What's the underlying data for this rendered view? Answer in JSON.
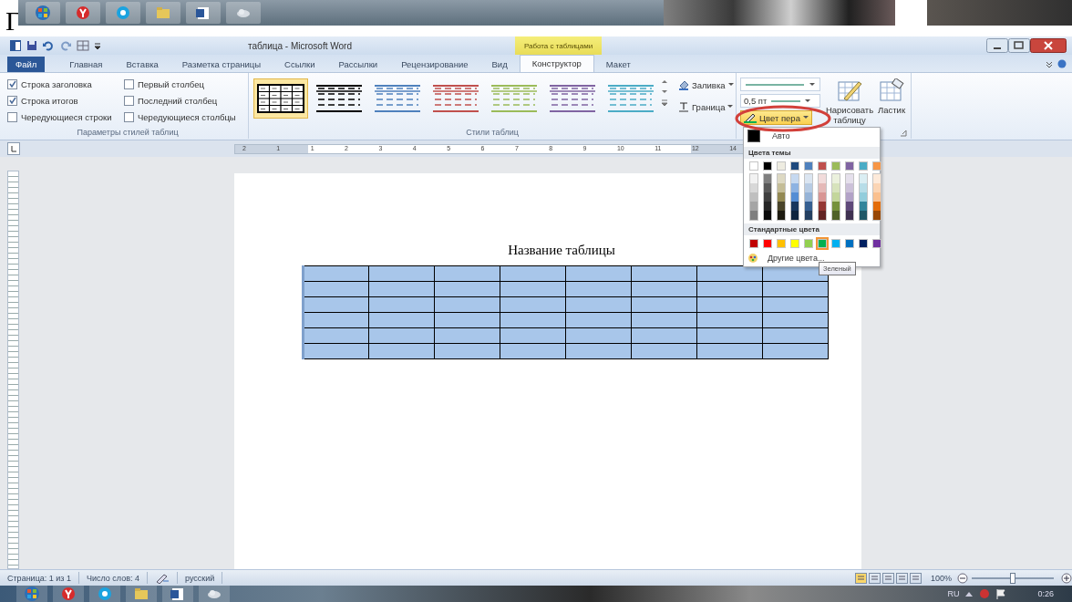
{
  "top_strip": {
    "letter": "Г"
  },
  "title_bar": {
    "title": "таблица - Microsoft Word",
    "context_header": "Работа с таблицами"
  },
  "tabs": [
    {
      "label": "Файл",
      "kind": "file",
      "selected": false
    },
    {
      "label": "Главная",
      "kind": "normal",
      "selected": false
    },
    {
      "label": "Вставка",
      "kind": "normal",
      "selected": false
    },
    {
      "label": "Разметка страницы",
      "kind": "normal",
      "selected": false
    },
    {
      "label": "Ссылки",
      "kind": "normal",
      "selected": false
    },
    {
      "label": "Рассылки",
      "kind": "normal",
      "selected": false
    },
    {
      "label": "Рецензирование",
      "kind": "normal",
      "selected": false
    },
    {
      "label": "Вид",
      "kind": "normal",
      "selected": false
    },
    {
      "label": "Конструктор",
      "kind": "context",
      "selected": true
    },
    {
      "label": "Макет",
      "kind": "context",
      "selected": false
    }
  ],
  "ribbon": {
    "style_options": {
      "label": "Параметры стилей таблиц",
      "items": [
        {
          "label": "Строка заголовка",
          "checked": true
        },
        {
          "label": "Строка итогов",
          "checked": true
        },
        {
          "label": "Чередующиеся строки",
          "checked": false
        },
        {
          "label": "Первый столбец",
          "checked": false
        },
        {
          "label": "Последний столбец",
          "checked": false
        },
        {
          "label": "Чередующиеся столбцы",
          "checked": false
        }
      ]
    },
    "table_styles": {
      "label": "Стили таблиц",
      "shading": "Заливка",
      "borders": "Граница",
      "styles": [
        {
          "kind": "grid",
          "color": "#000000",
          "selected": true
        },
        {
          "kind": "lines",
          "color": "#000000",
          "selected": false
        },
        {
          "kind": "lines",
          "color": "#4f81bd",
          "selected": false
        },
        {
          "kind": "lines",
          "color": "#c0504d",
          "selected": false
        },
        {
          "kind": "lines",
          "color": "#9bbb59",
          "selected": false
        },
        {
          "kind": "lines",
          "color": "#8064a2",
          "selected": false
        },
        {
          "kind": "lines",
          "color": "#4bacc6",
          "selected": false
        }
      ]
    },
    "draw_borders": {
      "pen_weight": "0,5 пт",
      "pen_color": "Цвет пера",
      "draw_table": "Нарисовать таблицу",
      "eraser": "Ластик"
    }
  },
  "ruler": {
    "marks": [
      "2",
      "1",
      "1",
      "2",
      "3",
      "4",
      "5",
      "6",
      "7",
      "8",
      "9",
      "10",
      "11",
      "12",
      "14"
    ]
  },
  "document": {
    "title": "Название таблицы",
    "table": {
      "rows": [
        {
          "cells": [
            {
              "kind": "empty"
            },
            {
              "kind": "empty"
            },
            {
              "kind": "empty"
            },
            {
              "kind": "empty"
            },
            {
              "kind": "empty"
            },
            {
              "kind": "empty"
            },
            {
              "kind": "empty"
            },
            {
              "kind": "empty"
            }
          ]
        },
        {
          "cells": [
            {
              "kind": "empty"
            },
            {
              "kind": "empty"
            },
            {
              "kind": "empty"
            },
            {
              "kind": "empty"
            },
            {
              "kind": "empty"
            },
            {
              "kind": "empty"
            },
            {
              "kind": "empty"
            },
            {
              "kind": "empty"
            }
          ]
        },
        {
          "cells": [
            {
              "kind": "empty"
            },
            {
              "kind": "empty"
            },
            {
              "kind": "empty"
            },
            {
              "kind": "empty"
            },
            {
              "kind": "empty"
            },
            {
              "kind": "empty"
            },
            {
              "kind": "empty"
            },
            {
              "kind": "empty"
            }
          ]
        },
        {
          "cells": [
            {
              "kind": "empty"
            },
            {
              "kind": "empty"
            },
            {
              "kind": "empty"
            },
            {
              "kind": "empty"
            },
            {
              "kind": "empty"
            },
            {
              "kind": "empty"
            },
            {
              "kind": "empty"
            },
            {
              "kind": "empty"
            }
          ]
        },
        {
          "cells": [
            {
              "kind": "empty"
            },
            {
              "kind": "empty"
            },
            {
              "kind": "empty"
            },
            {
              "kind": "empty"
            },
            {
              "kind": "empty"
            },
            {
              "kind": "empty"
            },
            {
              "kind": "empty"
            },
            {
              "kind": "empty"
            }
          ]
        },
        {
          "cells": [
            {
              "kind": "empty"
            },
            {
              "kind": "empty"
            },
            {
              "kind": "empty"
            },
            {
              "kind": "empty"
            },
            {
              "kind": "empty"
            },
            {
              "kind": "empty"
            },
            {
              "kind": "empty"
            },
            {
              "kind": "empty"
            }
          ]
        }
      ]
    }
  },
  "pen_color_menu": {
    "auto": "Авто",
    "theme_heading": "Цвета темы",
    "theme_colors": [
      {
        "color": "#ffffff",
        "shades": [
          {
            "color": "#f2f2f2"
          },
          {
            "color": "#d8d8d8"
          },
          {
            "color": "#bfbfbf"
          },
          {
            "color": "#a5a5a5"
          },
          {
            "color": "#7f7f7f"
          }
        ]
      },
      {
        "color": "#000000",
        "shades": [
          {
            "color": "#7f7f7f"
          },
          {
            "color": "#595959"
          },
          {
            "color": "#3f3f3f"
          },
          {
            "color": "#262626"
          },
          {
            "color": "#0c0c0c"
          }
        ]
      },
      {
        "color": "#eeece1",
        "shades": [
          {
            "color": "#ddd9c3"
          },
          {
            "color": "#c4bd97"
          },
          {
            "color": "#938953"
          },
          {
            "color": "#494429"
          },
          {
            "color": "#1d1b10"
          }
        ]
      },
      {
        "color": "#1f497d",
        "shades": [
          {
            "color": "#c6d9f0"
          },
          {
            "color": "#8db3e2"
          },
          {
            "color": "#548dd4"
          },
          {
            "color": "#17365d"
          },
          {
            "color": "#0f243e"
          }
        ]
      },
      {
        "color": "#4f81bd",
        "shades": [
          {
            "color": "#dbe5f1"
          },
          {
            "color": "#b8cce4"
          },
          {
            "color": "#95b3d7"
          },
          {
            "color": "#366092"
          },
          {
            "color": "#244061"
          }
        ]
      },
      {
        "color": "#c0504d",
        "shades": [
          {
            "color": "#f2dcdb"
          },
          {
            "color": "#e5b9b7"
          },
          {
            "color": "#d99694"
          },
          {
            "color": "#953734"
          },
          {
            "color": "#632423"
          }
        ]
      },
      {
        "color": "#9bbb59",
        "shades": [
          {
            "color": "#ebf1dd"
          },
          {
            "color": "#d7e3bc"
          },
          {
            "color": "#c3d69b"
          },
          {
            "color": "#76923c"
          },
          {
            "color": "#4f6128"
          }
        ]
      },
      {
        "color": "#8064a2",
        "shades": [
          {
            "color": "#e5e0ec"
          },
          {
            "color": "#ccc1d9"
          },
          {
            "color": "#b2a2c7"
          },
          {
            "color": "#5f497a"
          },
          {
            "color": "#3f3151"
          }
        ]
      },
      {
        "color": "#4bacc6",
        "shades": [
          {
            "color": "#dbeef3"
          },
          {
            "color": "#b7dde8"
          },
          {
            "color": "#92cddc"
          },
          {
            "color": "#31859b"
          },
          {
            "color": "#205867"
          }
        ]
      },
      {
        "color": "#f79646",
        "shades": [
          {
            "color": "#fdeada"
          },
          {
            "color": "#fbd5b5"
          },
          {
            "color": "#fac08f"
          },
          {
            "color": "#e36c09"
          },
          {
            "color": "#974806"
          }
        ]
      }
    ],
    "standard_heading": "Стандартные цвета",
    "standard_colors": [
      {
        "color": "#c00000",
        "selected": false
      },
      {
        "color": "#ff0000",
        "selected": false
      },
      {
        "color": "#ffc000",
        "selected": false
      },
      {
        "color": "#ffff00",
        "selected": false
      },
      {
        "color": "#92d050",
        "selected": false
      },
      {
        "color": "#00b050",
        "selected": true
      },
      {
        "color": "#00b0f0",
        "selected": false
      },
      {
        "color": "#0070c0",
        "selected": false
      },
      {
        "color": "#002060",
        "selected": false
      },
      {
        "color": "#7030a0",
        "selected": false
      }
    ],
    "more_colors": "Другие цвета...",
    "tooltip": "Зеленый"
  },
  "status_bar": {
    "page": "Страница: 1 из 1",
    "words": "Число слов: 4",
    "language": "русский",
    "zoom": "100%",
    "zoom_slider": {
      "level": 0.5
    }
  },
  "taskbar": {
    "language": "RU",
    "time": "0:26"
  }
}
